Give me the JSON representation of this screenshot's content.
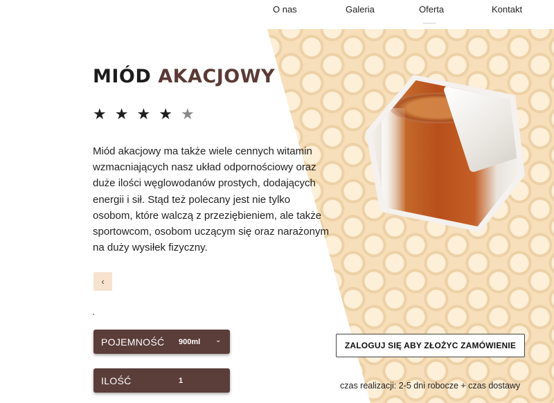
{
  "nav": {
    "items": [
      {
        "label": "O nas"
      },
      {
        "label": "Galeria"
      },
      {
        "label": "Oferta"
      },
      {
        "label": "Kontakt"
      }
    ]
  },
  "product": {
    "title_part1": "MIÓD",
    "title_part2": "AKACJOWY",
    "rating": 4,
    "rating_max": 5,
    "stars": [
      "★",
      "★",
      "★",
      "★",
      "★"
    ],
    "description": "Miód akacjowy ma także wiele cennych witamin wzmacniających nasz układ odpornościowy oraz duże ilości węglowodanów prostych, dodających energii i sił. Stąd też polecany jest nie tylko osobom, które walczą z przeziębieniem, ale także sportowcom, osobom uczącym się oraz narażonym na duży wysiłek fizyczny.",
    "image_icon": "honey-jar-photo"
  },
  "controls": {
    "prev_icon": "chevron-left-icon",
    "prev_glyph": "‹",
    "capacity_label": "POJEMNOŚĆ",
    "capacity_value": "900ml",
    "capacity_chevron": "⌄",
    "quantity_label": "ILOŚĆ",
    "quantity_value": "1"
  },
  "order": {
    "button_label": "ZALOGUJ SIĘ ABY ZŁOŻYC ZAMÓWIENIE",
    "delivery_text": "czas realizacji: 2-5 dni robocze + czas dostawy"
  },
  "colors": {
    "accent": "#5b3a35",
    "honeycomb": "#f6dfba",
    "field_bg": "#5b3d3a"
  }
}
